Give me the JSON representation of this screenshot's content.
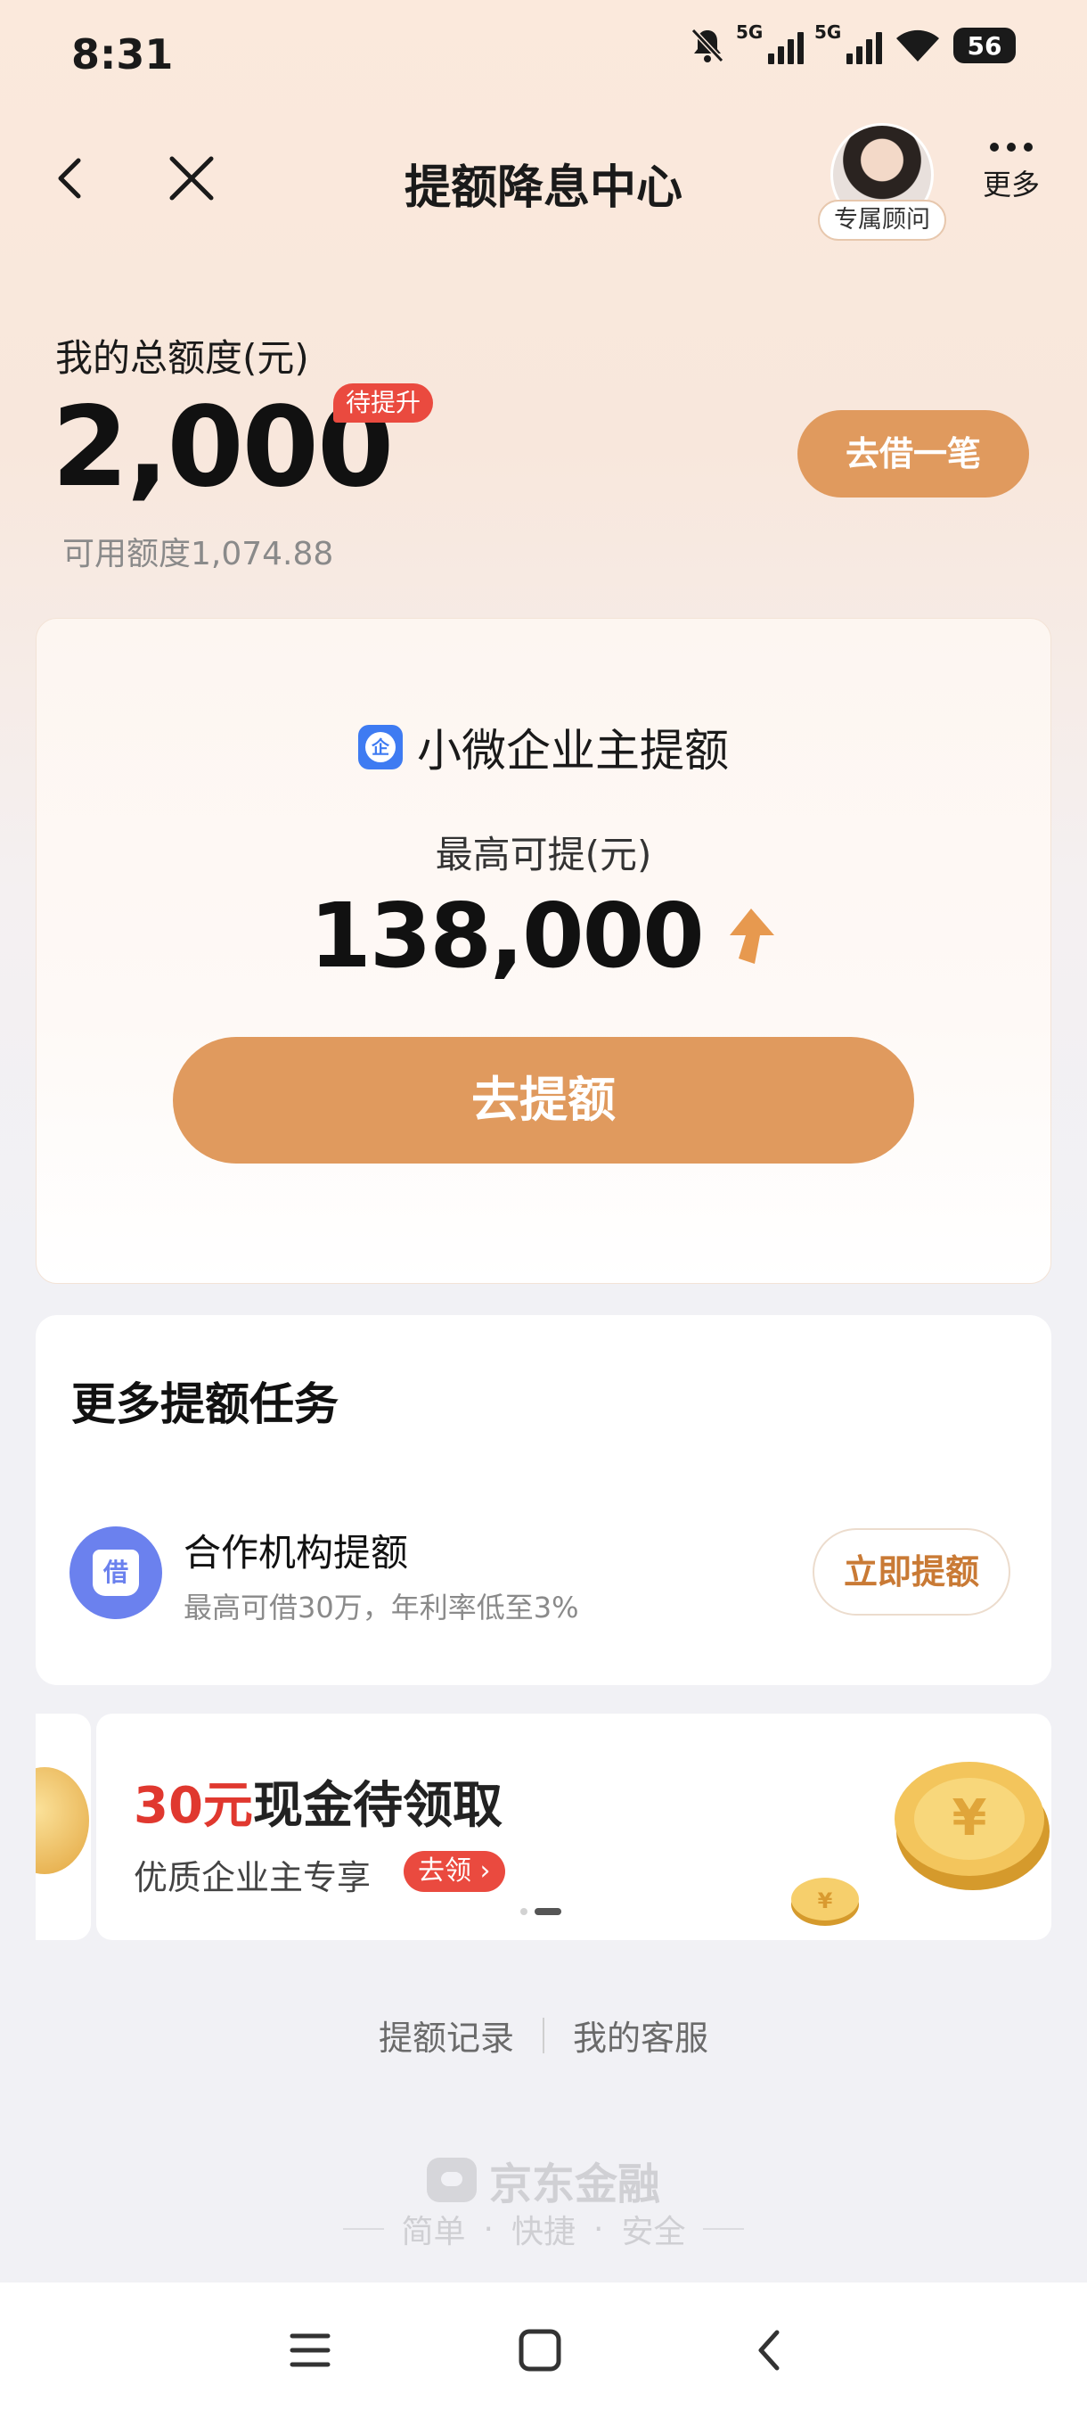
{
  "status_bar": {
    "time": "8:31",
    "network_1": "5G",
    "network_2": "5G",
    "battery": "56"
  },
  "nav": {
    "title": "提额降息中心",
    "advisor_label": "专属顾问",
    "more_label": "更多"
  },
  "quota": {
    "label": "我的总额度(元)",
    "value": "2,000",
    "badge": "待提升",
    "available": "可用额度1,074.88",
    "borrow_button": "去借一笔"
  },
  "promo": {
    "icon_text": "企",
    "title": "小微企业主提额",
    "subtitle": "最高可提(元)",
    "amount": "138,000",
    "button": "去提额"
  },
  "tasks": {
    "title": "更多提额任务",
    "items": [
      {
        "icon_text": "借",
        "name": "合作机构提额",
        "desc": "最高可借30万，年利率低至3%",
        "button": "立即提额"
      }
    ]
  },
  "banner": {
    "amount_text": "30元",
    "title_rest": "现金待领取",
    "subtitle": "优质企业主专享",
    "claim_button": "去领 ›",
    "active_slide": 2,
    "slide_count": 2
  },
  "footer": {
    "link_records": "提额记录",
    "link_service": "我的客服",
    "brand": "京东金融",
    "slogan": [
      "简单",
      "·",
      "快捷",
      "·",
      "安全"
    ]
  },
  "colors": {
    "accent": "#e09a5e",
    "badge_red": "#ea4a3f",
    "task_icon": "#6b81ee",
    "enterprise_icon": "#3e7bf2"
  }
}
